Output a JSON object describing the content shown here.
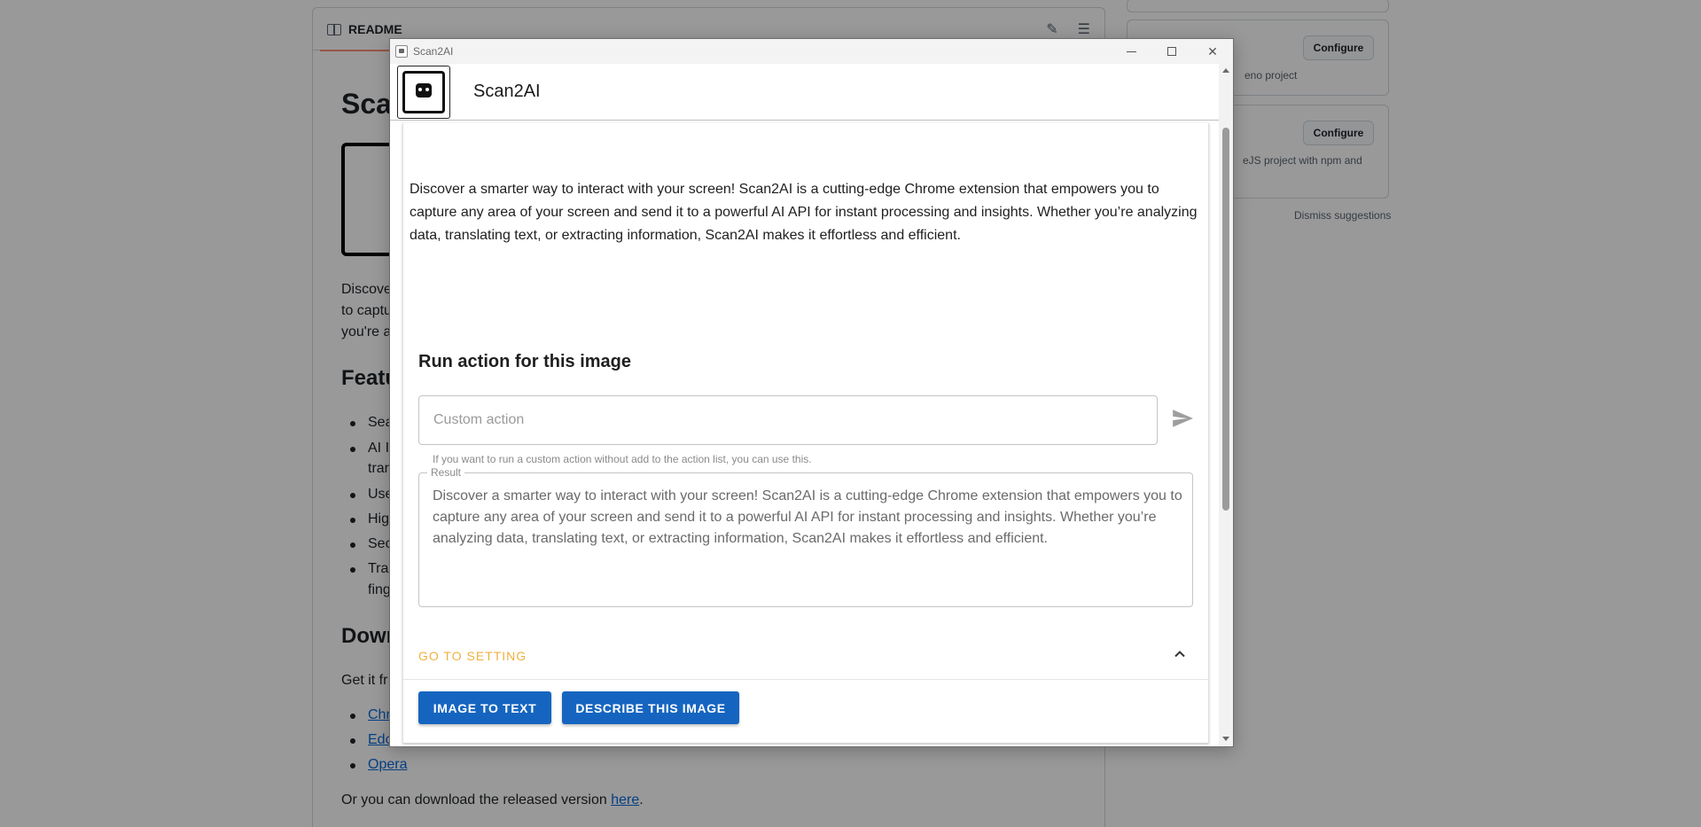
{
  "background": {
    "readme_tab": "README",
    "heading_partial": "Scan",
    "para_lines": [
      "Discove",
      "to captu",
      "you're a"
    ],
    "features_heading_partial": "Featu",
    "feature_items_partial": [
      "Sea",
      "AI I",
      "trar",
      "Use",
      "Hig",
      "Sec",
      "Trar",
      "fing"
    ],
    "download_heading_partial": "Down",
    "get_it_partial": "Get it fr",
    "links_partial": [
      "Chr",
      "Edc",
      "Opera"
    ],
    "footer_text_prefix": "Or you can download the released version ",
    "footer_link": "here",
    "footer_text_suffix": ".",
    "side": {
      "configure_label": "Configure",
      "card1_desc": "eno project",
      "card2_desc_line1": "eJS project with npm and",
      "dismiss": "Dismiss suggestions"
    }
  },
  "window": {
    "title": "Scan2AI",
    "app_name": "Scan2AI",
    "intro": "Discover a smarter way to interact with your screen! Scan2AI is a cutting-edge Chrome extension that empowers you to capture any area of your screen and send it to a powerful AI API for instant processing and insights. Whether you’re analyzing data, translating text, or extracting information, Scan2AI makes it effortless and efficient.",
    "run_title": "Run action for this image",
    "action_placeholder": "Custom action",
    "action_value": "",
    "helper": "If you want to run a custom action without add to the action list, you can use this.",
    "result_label": "Result",
    "result_text": "Discover a smarter way to interact with your screen! Scan2AI is a cutting-edge Chrome extension that empowers you to capture any area of your screen and send it to a powerful AI API for instant processing and insights. Whether you’re analyzing data, translating text, or extracting information, Scan2AI makes it effortless and efficient.",
    "accordion_label": "GO TO SETTING",
    "buttons": {
      "image_to_text": "IMAGE TO TEXT",
      "describe": "DESCRIBE THIS IMAGE"
    }
  },
  "colors": {
    "primary": "#1565c0",
    "accent": "#f0b03f",
    "link": "#0969da"
  }
}
